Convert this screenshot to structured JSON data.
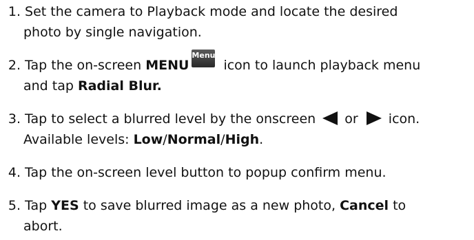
{
  "steps": [
    {
      "number": "1.",
      "line1": "Set the camera to Playback mode and locate the desired",
      "line2": "photo by single navigation."
    },
    {
      "number": "2.",
      "pre": "Tap the on-screen ",
      "menu_bold": "MENU",
      "menu_icon_label": "Menu",
      "post": " icon to launch playback menu",
      "line2_pre": "and tap ",
      "line2_bold": "Radial Blur."
    },
    {
      "number": "3.",
      "pre": "Tap to select a blurred level by the onscreen ",
      "mid": " or ",
      "post": " icon.",
      "line2_pre": "Available levels: ",
      "low": "Low",
      "sep1": "/",
      "normal": "Normal",
      "sep2": "/",
      "high": "High",
      "end": "."
    },
    {
      "number": "4.",
      "text": "Tap the on-screen level button to popup confirm menu."
    },
    {
      "number": "5.",
      "pre": "Tap ",
      "yes": "YES",
      "mid": " to save blurred image as a new photo, ",
      "cancel": "Cancel",
      "post": " to",
      "line2": "abort."
    }
  ]
}
